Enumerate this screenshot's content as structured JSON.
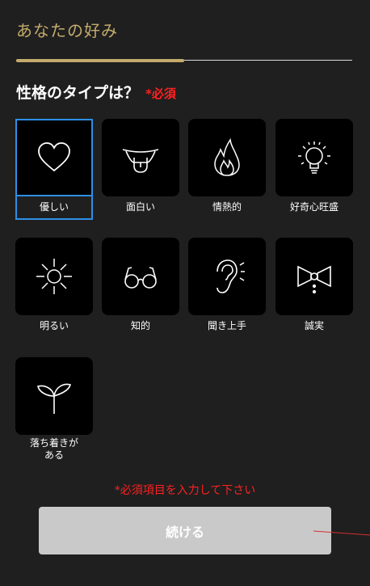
{
  "header": {
    "title": "あなたの好み"
  },
  "progress": {
    "value": 0.5
  },
  "question": {
    "text": "性格のタイプは？",
    "required": "*必須"
  },
  "options": [
    {
      "label": "優しい",
      "icon": "heart-icon",
      "selected": true
    },
    {
      "label": "面白い",
      "icon": "tongue-out-icon",
      "selected": false
    },
    {
      "label": "情熱的",
      "icon": "flame-icon",
      "selected": false
    },
    {
      "label": "好奇心旺盛",
      "icon": "lightbulb-icon",
      "selected": false
    },
    {
      "label": "明るい",
      "icon": "sun-icon",
      "selected": false
    },
    {
      "label": "知的",
      "icon": "glasses-icon",
      "selected": false
    },
    {
      "label": "聞き上手",
      "icon": "ear-icon",
      "selected": false
    },
    {
      "label": "誠実",
      "icon": "bow-tie-icon",
      "selected": false
    },
    {
      "label": "落ち着きが\nある",
      "icon": "sprout-icon",
      "selected": false
    }
  ],
  "error": {
    "text": "*必須項目を入力して下さい"
  },
  "footer": {
    "continue_label": "続ける"
  },
  "colors": {
    "accent": "#c4ab6c",
    "selected_border": "#2e8fe6",
    "error": "#ff2020",
    "button": "#c9c9c9"
  }
}
